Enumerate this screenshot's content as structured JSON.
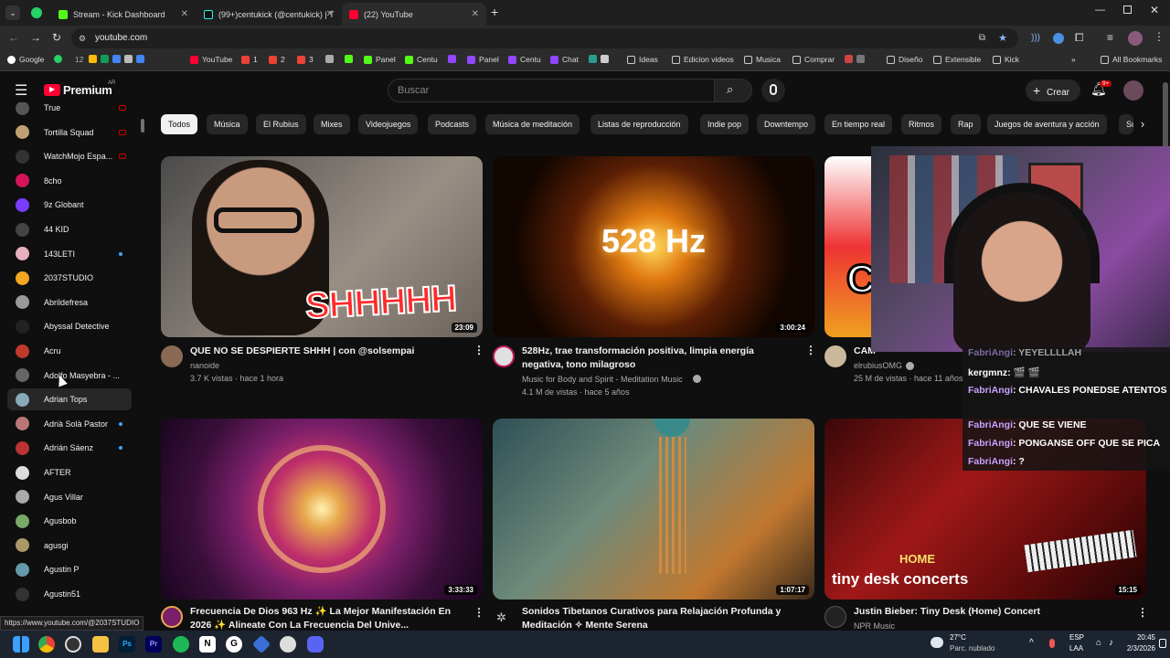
{
  "browser": {
    "tabs": [
      {
        "title": "Stream - Kick Dashboard",
        "color": "#53fc18"
      },
      {
        "title": "(99+)centukick (@centukick) | T",
        "color": "#111111"
      },
      {
        "title": "(22) YouTube",
        "color": "#ff0033"
      }
    ],
    "url": "youtube.com",
    "bookmarks": [
      "Google",
      "12",
      "YouTube",
      "1",
      "2",
      "3",
      "Panel",
      "Centu",
      "Panel",
      "Centu",
      "Chat",
      "Ideas",
      "Edicion videos",
      "Musica",
      "Comprar",
      "Diseño",
      "Extensible",
      "Kick"
    ],
    "all_bookmarks": "All Bookmarks",
    "status_url": "https://www.youtube.com/@2037STUDIO"
  },
  "youtube": {
    "logo_text": "Premium",
    "region": "AR",
    "search_placeholder": "Buscar",
    "create_label": "Crear",
    "notif_count": "9+",
    "chips": [
      "Todos",
      "Música",
      "El Rubius",
      "Mixes",
      "Videojuegos",
      "Podcasts",
      "Música de meditación",
      "Listas de reproducción",
      "Indie pop",
      "Downtempo",
      "En tiempo real",
      "Ritmos",
      "Rap",
      "Juegos de aventura y acción",
      "Su"
    ],
    "sidebar": [
      {
        "name": "True",
        "color": "#555",
        "live": true
      },
      {
        "name": "Tortilla Squad",
        "color": "#c0a070",
        "live": true
      },
      {
        "name": "WatchMojo Espa...",
        "color": "#333",
        "live": true
      },
      {
        "name": "8cho",
        "color": "#d4145a",
        "dot": false
      },
      {
        "name": "9z Globant",
        "color": "#7a3cff",
        "dot": false
      },
      {
        "name": "44 KID",
        "color": "#444",
        "dot": false
      },
      {
        "name": "143LETI",
        "color": "#e8b0c0",
        "dot": true
      },
      {
        "name": "2037STUDIO",
        "color": "#f5a623",
        "dot": false
      },
      {
        "name": "Abrildefresa",
        "color": "#999",
        "dot": false
      },
      {
        "name": "Abyssal Detective",
        "color": "#222",
        "dot": false
      },
      {
        "name": "Acru",
        "color": "#c0392b",
        "dot": false
      },
      {
        "name": "Adolfo Masyebra - ...",
        "color": "#666",
        "dot": false
      },
      {
        "name": "Adrian Tops",
        "color": "#8ab",
        "dot": false
      },
      {
        "name": "Adrià Solà Pastor",
        "color": "#b77",
        "dot": true
      },
      {
        "name": "Adrián Sáenz",
        "color": "#b33",
        "dot": true
      },
      {
        "name": "AFTER",
        "color": "#ddd",
        "dot": false
      },
      {
        "name": "Agus Villar",
        "color": "#aaa",
        "dot": false
      },
      {
        "name": "Agusbob",
        "color": "#7a6",
        "dot": false
      },
      {
        "name": "agusgi",
        "color": "#a96",
        "dot": false
      },
      {
        "name": "Agustin P",
        "color": "#69a",
        "dot": false
      },
      {
        "name": "Agustin51",
        "color": "#333",
        "dot": false
      }
    ],
    "videos": [
      {
        "title": "QUE NO SE DESPIERTE SHHH | con  @solsempai",
        "channel": "nanoide",
        "meta": "3.7 K vistas · hace 1 hora",
        "duration": "23:09",
        "thumb_text": "SHHHHH"
      },
      {
        "title": "528Hz, trae transformación positiva, limpia energía negativa, tono milagroso",
        "channel": "Music for Body and Spirit - Meditation Music",
        "meta": "4.1 M de vistas · hace 5 años",
        "duration": "3:00:24",
        "thumb_text": "528 Hz"
      },
      {
        "title": "CAM",
        "channel": "elrubiusOMG",
        "meta": "25 M de vistas · hace 11 años",
        "duration": "",
        "thumb_text": "C"
      },
      {
        "title": "Frecuencia De Dios 963 Hz ✨ La Mejor Manifestación En 2026 ✨ Alineate Con La Frecuencia Del Unive...",
        "channel": "",
        "meta": "",
        "duration": "3:33:33",
        "thumb_text": ""
      },
      {
        "title": "Sonidos Tibetanos Curativos para Relajación Profunda y Meditación ✧ Mente Serena",
        "channel": "",
        "meta": "",
        "duration": "1:07:17",
        "thumb_text": ""
      },
      {
        "title": "Justin Bieber: Tiny Desk (Home) Concert",
        "channel": "NPR Music",
        "meta": "",
        "duration": "15:15",
        "thumb_text": "tiny desk concerts"
      }
    ]
  },
  "chat": [
    {
      "user": "FabriAngi",
      "msg": "YEYELLLLAH"
    },
    {
      "user": "kergmnz",
      "msg": "🎬 🎬"
    },
    {
      "user": "FabriAngi",
      "msg": "CHAVALES PONEDSE ATENTOS"
    },
    {
      "user": "FabriAngi",
      "msg": "QUE SE VIENE"
    },
    {
      "user": "FabriAngi",
      "msg": "PONGANSE OFF QUE SE PICA"
    },
    {
      "user": "FabriAngi",
      "msg": "?"
    }
  ],
  "taskbar": {
    "temp": "27°C",
    "weather": "Parc. nublado",
    "lang": "ESP",
    "lang2": "LAA",
    "time": "20:45",
    "date": "2/3/2026"
  }
}
